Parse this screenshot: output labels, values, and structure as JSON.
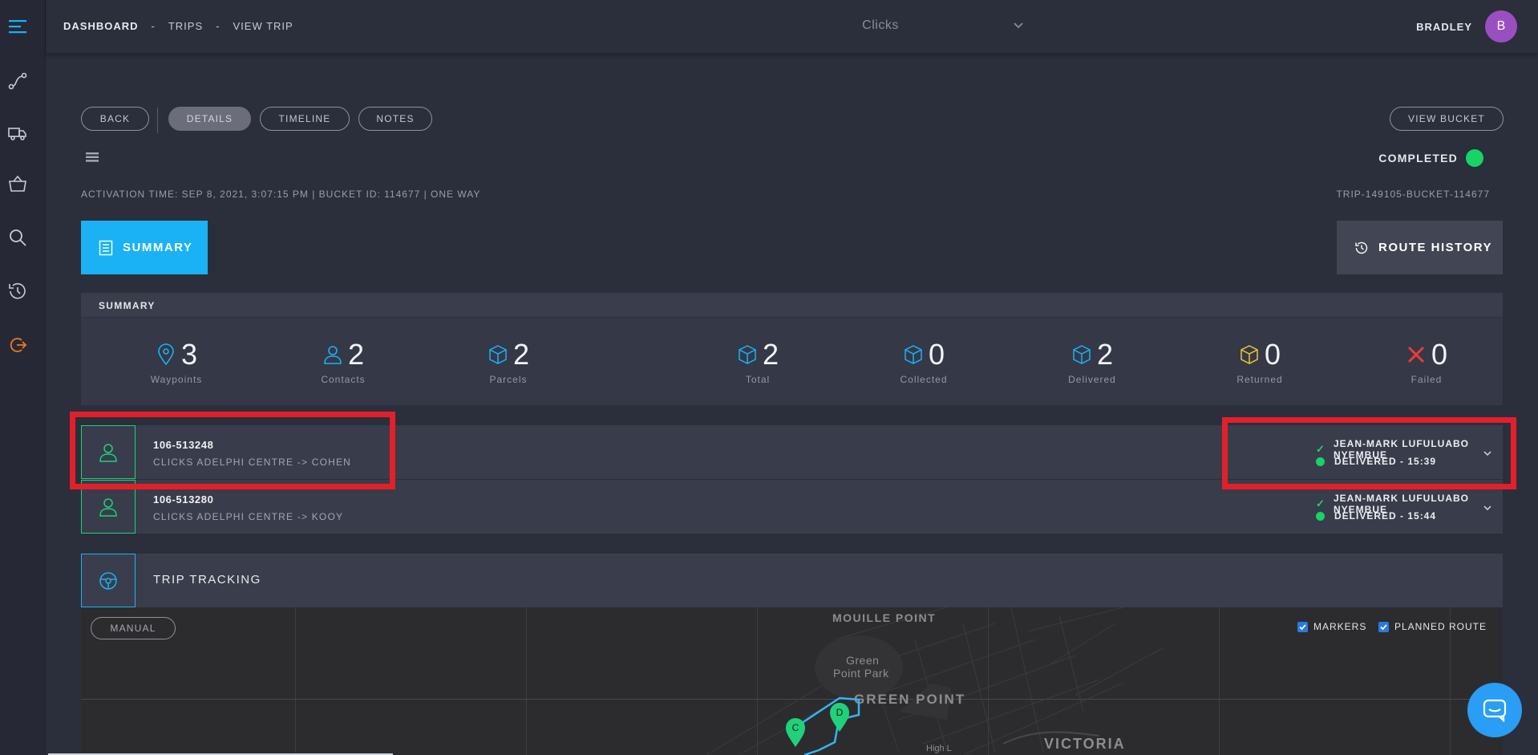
{
  "breadcrumb": [
    "DASHBOARD",
    "TRIPS",
    "VIEW TRIP"
  ],
  "breadcrumb_sep": "-",
  "store_select": {
    "value": "Clicks"
  },
  "user": {
    "name": "BRADLEY",
    "initial": "B"
  },
  "tabs": {
    "back": "BACK",
    "details": "DETAILS",
    "timeline": "TIMELINE",
    "notes": "NOTES",
    "view_bucket": "VIEW BUCKET"
  },
  "status": {
    "label": "COMPLETED",
    "color": "#18d365"
  },
  "meta": {
    "activation": "ACTIVATION TIME: SEP 8, 2021, 3:07:15 PM | BUCKET ID: 114677 | ONE WAY",
    "trip_ref": "TRIP-149105-BUCKET-114677"
  },
  "buttons": {
    "summary": "SUMMARY",
    "route_history": "ROUTE HISTORY"
  },
  "summary": {
    "title": "SUMMARY",
    "stats": [
      {
        "label": "Waypoints",
        "value": "3",
        "icon": "map-pin-icon"
      },
      {
        "label": "Contacts",
        "value": "2",
        "icon": "person-icon"
      },
      {
        "label": "Parcels",
        "value": "2",
        "icon": "box-icon"
      },
      {
        "label": "Total",
        "value": "2",
        "icon": "box-icon"
      },
      {
        "label": "Collected",
        "value": "0",
        "icon": "box-icon"
      },
      {
        "label": "Delivered",
        "value": "2",
        "icon": "box-icon"
      },
      {
        "label": "Returned",
        "value": "0",
        "icon": "box-yellow-icon"
      },
      {
        "label": "Failed",
        "value": "0",
        "icon": "x-icon"
      }
    ]
  },
  "waypoints": [
    {
      "id": "106-513248",
      "route": "CLICKS ADELPHI CENTRE -> COHEN",
      "driver": "JEAN-MARK LUFULUABO NYEMBUE",
      "status": "DELIVERED - 15:39"
    },
    {
      "id": "106-513280",
      "route": "CLICKS ADELPHI CENTRE -> KOOY",
      "driver": "JEAN-MARK LUFULUABO NYEMBUE",
      "status": "DELIVERED - 15:44"
    }
  ],
  "tracking": {
    "title": "TRIP TRACKING",
    "manual": "MANUAL",
    "markers_label": "MARKERS",
    "planned_route_label": "PLANNED ROUTE",
    "map_labels": {
      "mouille": "MOUILLE POINT",
      "green_park_1": "Green",
      "green_park_2": "Point Park",
      "green_point": "GREEN POINT",
      "victoria": "VICTORIA",
      "high": "High L"
    },
    "pins": [
      "C",
      "D"
    ]
  },
  "colors": {
    "accent": "#1ab2f4",
    "success": "#18d365",
    "highlight": "#e3202a"
  }
}
